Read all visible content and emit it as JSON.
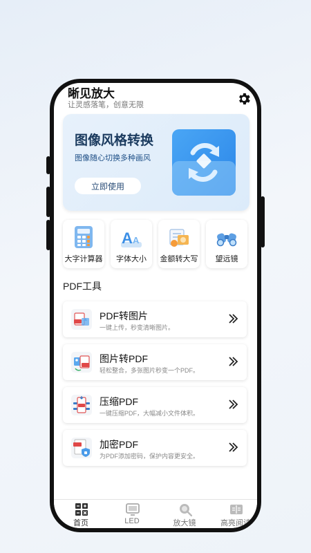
{
  "app": {
    "title": "晰见放大",
    "subtitle": "让灵感落笔，创意无限",
    "settings_icon": "gear-icon"
  },
  "banner": {
    "title": "图像风格转换",
    "subtitle": "图像随心切换多种画风",
    "button_label": "立即使用",
    "illustration": "image-convert-icon"
  },
  "tools": [
    {
      "label": "大字计算器",
      "icon": "calculator-icon"
    },
    {
      "label": "字体大小",
      "icon": "font-size-icon"
    },
    {
      "label": "金额转大写",
      "icon": "amount-convert-icon"
    },
    {
      "label": "望远镜",
      "icon": "binoculars-icon"
    }
  ],
  "pdf_section": {
    "title": "PDF工具",
    "items": [
      {
        "name": "PDF转图片",
        "desc": "一键上传，秒变清晰图片。",
        "icon": "pdf-to-image-icon"
      },
      {
        "name": "图片转PDF",
        "desc": "轻松整合，多张图片秒变一个PDF。",
        "icon": "image-to-pdf-icon"
      },
      {
        "name": "压缩PDF",
        "desc": "一键压缩PDF，大幅减小文件体积。",
        "icon": "compress-pdf-icon"
      },
      {
        "name": "加密PDF",
        "desc": "为PDF添加密码，保护内容更安全。",
        "icon": "encrypt-pdf-icon"
      }
    ]
  },
  "tabbar": [
    {
      "label": "首页",
      "icon": "home-grid-icon",
      "active": true
    },
    {
      "label": "LED",
      "icon": "led-screen-icon",
      "active": false
    },
    {
      "label": "放大镜",
      "icon": "magnifier-icon",
      "active": false
    },
    {
      "label": "高亮阅读",
      "icon": "book-icon",
      "active": false
    }
  ],
  "colors": {
    "accent": "#2f8ef0",
    "banner_bg": "#e3eefa",
    "frame": "#111111"
  }
}
